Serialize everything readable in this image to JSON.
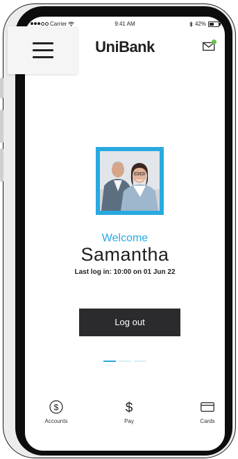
{
  "status_bar": {
    "carrier": "Carrier",
    "time": "9:41 AM",
    "battery": "42%"
  },
  "header": {
    "brand": "UniBank",
    "icons": [
      "menu-icon",
      "mail-icon"
    ],
    "notification_color": "#6ac14a"
  },
  "profile": {
    "welcome": "Welcome",
    "name": "Samantha",
    "last_login": "Last log in: 10:00 on 01 Jun 22",
    "frame_color": "#29a9e1"
  },
  "actions": {
    "logout_label": "Log out"
  },
  "pager": {
    "pages": 3,
    "active": 1
  },
  "bottom_nav": {
    "items": [
      {
        "label": "Accounts",
        "icon": "dollar-circle-icon"
      },
      {
        "label": "Pay",
        "icon": "dollar-sign-icon"
      },
      {
        "label": "Cards",
        "icon": "card-icon"
      }
    ]
  },
  "colors": {
    "accent": "#29a9e1",
    "button_bg": "#2b2b2e"
  }
}
